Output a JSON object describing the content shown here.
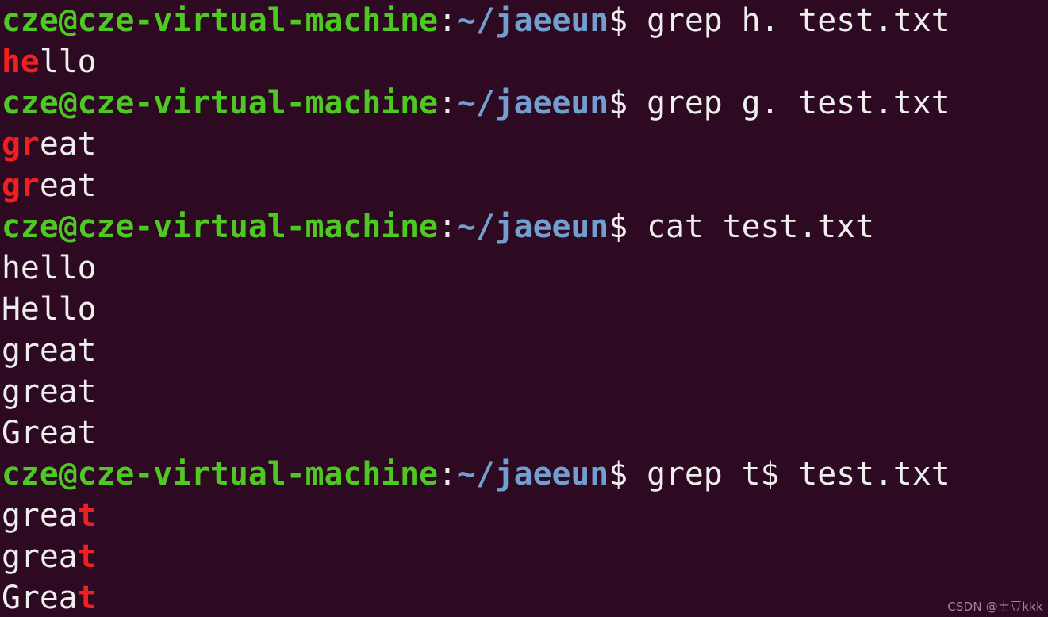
{
  "terminal": {
    "background_color": "#2d0922",
    "default_text_color": "#eeeeec",
    "prompt_user_color": "#4ec923",
    "prompt_path_color": "#729fcf",
    "match_highlight_color": "#ef2020",
    "prompt": {
      "user_host": "cze@cze-virtual-machine",
      "separator": ":",
      "path": "~/jaeeun",
      "symbol": "$"
    },
    "lines": [
      {
        "type": "prompt",
        "user_host": "cze@cze-virtual-machine",
        "separator": ":",
        "path": "~/jaeeun",
        "symbol": "$",
        "command": " grep h. test.txt"
      },
      {
        "type": "output",
        "match": "he",
        "rest": "llo",
        "full": "hello"
      },
      {
        "type": "prompt",
        "user_host": "cze@cze-virtual-machine",
        "separator": ":",
        "path": "~/jaeeun",
        "symbol": "$",
        "command": " grep g. test.txt"
      },
      {
        "type": "output",
        "match": "gr",
        "rest": "eat",
        "full": "great"
      },
      {
        "type": "output",
        "match": "gr",
        "rest": "eat",
        "full": "great"
      },
      {
        "type": "prompt",
        "user_host": "cze@cze-virtual-machine",
        "separator": ":",
        "path": "~/jaeeun",
        "symbol": "$",
        "command": " cat test.txt"
      },
      {
        "type": "plain",
        "full": "hello"
      },
      {
        "type": "plain",
        "full": "Hello"
      },
      {
        "type": "plain",
        "full": "great"
      },
      {
        "type": "plain",
        "full": "great"
      },
      {
        "type": "plain",
        "full": "Great"
      },
      {
        "type": "prompt",
        "user_host": "cze@cze-virtual-machine",
        "separator": ":",
        "path": "~/jaeeun",
        "symbol": "$",
        "command": " grep t$ test.txt"
      },
      {
        "type": "output-suffix",
        "rest": "grea",
        "match": "t",
        "full": "great"
      },
      {
        "type": "output-suffix",
        "rest": "grea",
        "match": "t",
        "full": "great"
      },
      {
        "type": "output-suffix",
        "rest": "Grea",
        "match": "t",
        "full": "Great"
      }
    ]
  },
  "watermark": {
    "text": "CSDN @土豆kkk"
  }
}
